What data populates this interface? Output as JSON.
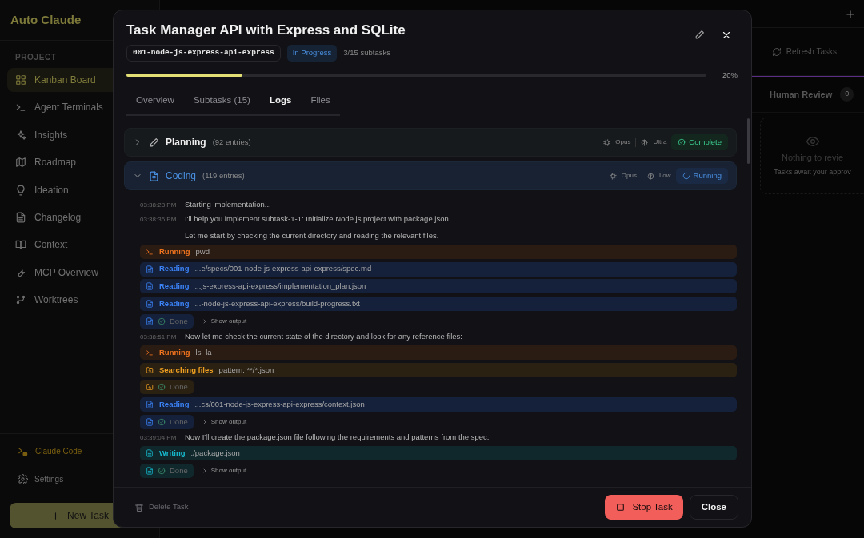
{
  "sidebar": {
    "app_title": "Auto Claude",
    "section": "PROJECT",
    "items": [
      {
        "label": "Kanban Board",
        "selected": true
      },
      {
        "label": "Agent Terminals",
        "selected": false
      },
      {
        "label": "Insights",
        "selected": false
      },
      {
        "label": "Roadmap",
        "selected": false
      },
      {
        "label": "Ideation",
        "selected": false
      },
      {
        "label": "Changelog",
        "selected": false
      },
      {
        "label": "Context",
        "selected": false
      },
      {
        "label": "MCP Overview",
        "selected": false
      },
      {
        "label": "Worktrees",
        "selected": false
      }
    ],
    "footer_link": "Claude Code",
    "settings": "Settings",
    "new_task": "New Task"
  },
  "board": {
    "refresh": "Refresh Tasks",
    "column": {
      "title": "Human Review",
      "count": "0",
      "empty_title": "Nothing to revie",
      "empty_text": "Tasks await your approv"
    }
  },
  "modal": {
    "title": "Task Manager API with Express and SQLite",
    "spec_id": "001-node-js-express-api-express",
    "status": "In Progress",
    "subtasks": "3/15 subtasks",
    "progress": {
      "level": 0.2,
      "reading": "20%"
    },
    "tabs": [
      {
        "label": "Overview",
        "selected": false
      },
      {
        "label": "Subtasks (15)",
        "selected": false
      },
      {
        "label": "Logs",
        "selected": true
      },
      {
        "label": "Files",
        "selected": false
      }
    ],
    "phases": [
      {
        "name": "Planning",
        "count": "(92 entries)",
        "expanded": false,
        "model": "Opus",
        "thinking": "Ultra",
        "status": "Complete",
        "kind": "complete"
      },
      {
        "name": "Coding",
        "count": "(119 entries)",
        "expanded": true,
        "model": "Opus",
        "thinking": "Low",
        "status": "Running",
        "kind": "running",
        "entries": [
          {
            "kind": "message",
            "time": "03:38:28 PM",
            "paragraphs": [
              "Starting implementation..."
            ]
          },
          {
            "kind": "message",
            "time": "03:38:36 PM",
            "paragraphs": [
              "I'll help you implement subtask-1-1: Initialize Node.js project with package.json.",
              "Let me start by checking the current directory and reading the relevant files."
            ]
          },
          {
            "kind": "command",
            "calls": [
              {
                "action": "Running",
                "detail": "pwd"
              }
            ]
          },
          {
            "kind": "read",
            "calls": [
              {
                "action": "Reading",
                "detail": "...e/specs/001-node-js-express-api-express/spec.md"
              },
              {
                "action": "Reading",
                "detail": "...js-express-api-express/implementation_plan.json"
              },
              {
                "action": "Reading",
                "detail": "...-node-js-express-api-express/build-progress.txt"
              }
            ],
            "result": {
              "label": "Done",
              "output": "Show output"
            }
          },
          {
            "kind": "message",
            "time": "03:38:51 PM",
            "paragraphs": [
              "Now let me check the current state of the directory and look for any reference files:"
            ]
          },
          {
            "kind": "command",
            "calls": [
              {
                "action": "Running",
                "detail": "ls -la"
              }
            ]
          },
          {
            "kind": "search",
            "calls": [
              {
                "action": "Searching files",
                "detail": "pattern: **/*.json"
              }
            ],
            "result": {
              "label": "Done"
            }
          },
          {
            "kind": "read",
            "calls": [
              {
                "action": "Reading",
                "detail": "...cs/001-node-js-express-api-express/context.json"
              }
            ],
            "result": {
              "label": "Done",
              "output": "Show output"
            }
          },
          {
            "kind": "message",
            "time": "03:39:04 PM",
            "paragraphs": [
              "Now I'll create the package.json file following the requirements and patterns from the spec:"
            ]
          },
          {
            "kind": "write",
            "calls": [
              {
                "action": "Writing",
                "detail": "./package.json"
              }
            ],
            "result": {
              "label": "Done",
              "output": "Show output"
            }
          }
        ]
      }
    ],
    "footer": {
      "delete": "Delete Task",
      "delete_disabled": true,
      "stop": "Stop Task",
      "close": "Close"
    }
  }
}
